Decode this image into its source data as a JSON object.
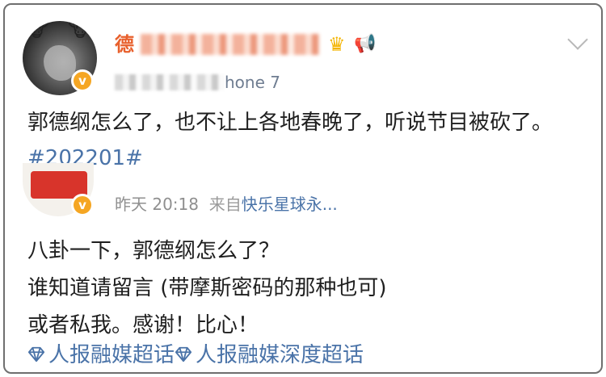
{
  "post1": {
    "username_visible": "德",
    "meta_device": "hone 7",
    "text_main": "郭德纲怎么了，也不让上各地春晚了，听说节目被砍了。",
    "hashtag": "#202201#",
    "icons": [
      "crown-icon",
      "megaphone-icon",
      "chevron-down-icon",
      "verified-badge-icon"
    ]
  },
  "post2": {
    "time": "昨天 20:18",
    "from_label": "来自",
    "source": "快乐星球永...",
    "lines": [
      "八卦一下，郭德纲怎么了？",
      "谁知道请留言 (带摩斯密码的那种也可)",
      "或者私我。感谢！比心！"
    ],
    "topics": [
      "人报融媒超话",
      "人报融媒深度超话"
    ]
  },
  "colors": {
    "link": "#4a73a8",
    "username": "#e8602c",
    "verified": "#f5a623"
  }
}
